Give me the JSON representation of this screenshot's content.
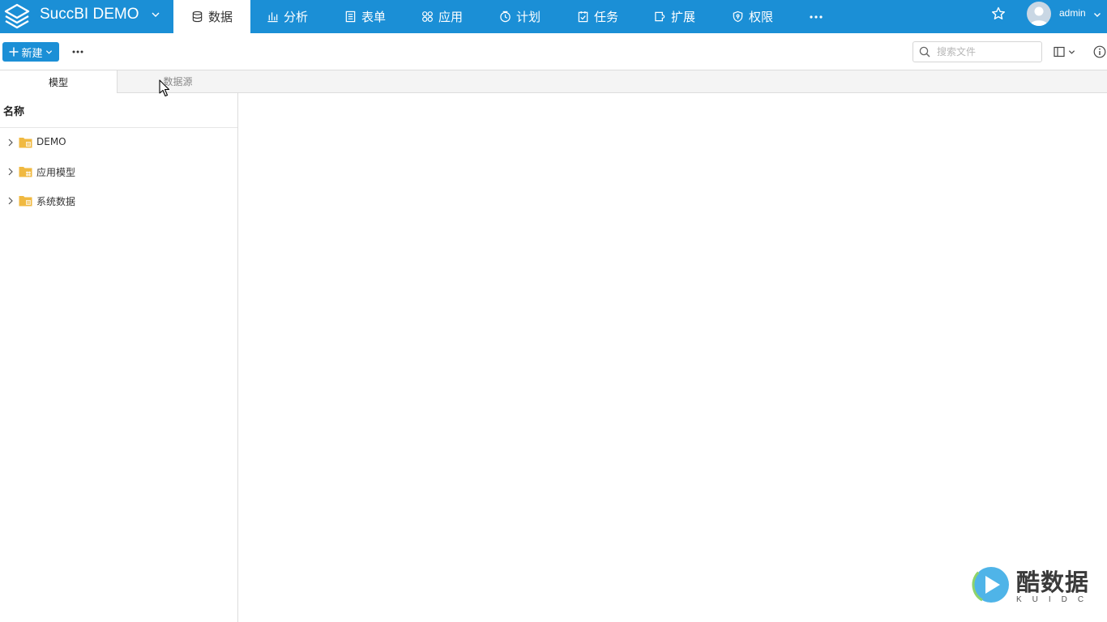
{
  "app": {
    "title": "SuccBI DEMO"
  },
  "nav": {
    "items": [
      {
        "label": "数据",
        "icon": "database-icon"
      },
      {
        "label": "分析",
        "icon": "bar-chart-icon"
      },
      {
        "label": "表单",
        "icon": "form-icon"
      },
      {
        "label": "应用",
        "icon": "apps-icon"
      },
      {
        "label": "计划",
        "icon": "clock-icon"
      },
      {
        "label": "任务",
        "icon": "task-icon"
      },
      {
        "label": "扩展",
        "icon": "extension-icon"
      },
      {
        "label": "权限",
        "icon": "shield-icon"
      }
    ],
    "active_index": 0
  },
  "header": {
    "user": "admin"
  },
  "toolbar": {
    "new_label": "新建",
    "search_placeholder": "搜索文件"
  },
  "left_panel": {
    "tabs": [
      {
        "label": "模型"
      },
      {
        "label": "数据源"
      }
    ],
    "column_header": "名称",
    "tree_items": [
      {
        "label": "DEMO"
      },
      {
        "label": "应用模型"
      },
      {
        "label": "系统数据"
      }
    ]
  },
  "watermark": {
    "text": "酷数据",
    "sub": "KUIDC"
  },
  "colors": {
    "primary": "#1b8fd6",
    "folder": "#f0b941"
  }
}
